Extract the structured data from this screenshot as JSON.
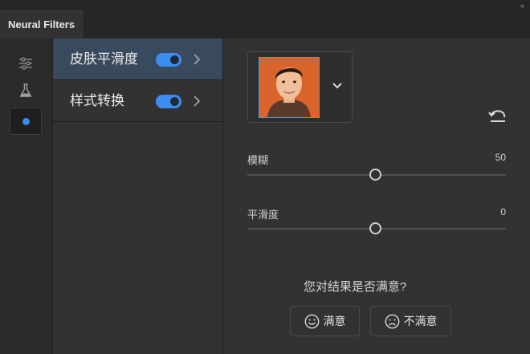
{
  "panel": {
    "tab_title": "Neural Filters",
    "collapse_glyph": "››"
  },
  "rail": {
    "items": [
      {
        "icon": "sliders-icon"
      },
      {
        "icon": "flask-icon"
      },
      {
        "icon": "dot-icon",
        "active": true
      }
    ]
  },
  "filters": [
    {
      "label": "皮肤平滑度",
      "enabled": true,
      "selected": true
    },
    {
      "label": "样式转换",
      "enabled": true,
      "selected": false
    }
  ],
  "settings": {
    "sliders": [
      {
        "label": "模糊",
        "value": "50"
      },
      {
        "label": "平滑度",
        "value": "0"
      }
    ]
  },
  "feedback": {
    "question": "您对结果是否满意?",
    "satisfied": "满意",
    "unsatisfied": "不满意"
  },
  "colors": {
    "accent": "#3b8ef0",
    "selected_row": "#3a4a5e",
    "thumbnail_bg": "#d9642c"
  }
}
